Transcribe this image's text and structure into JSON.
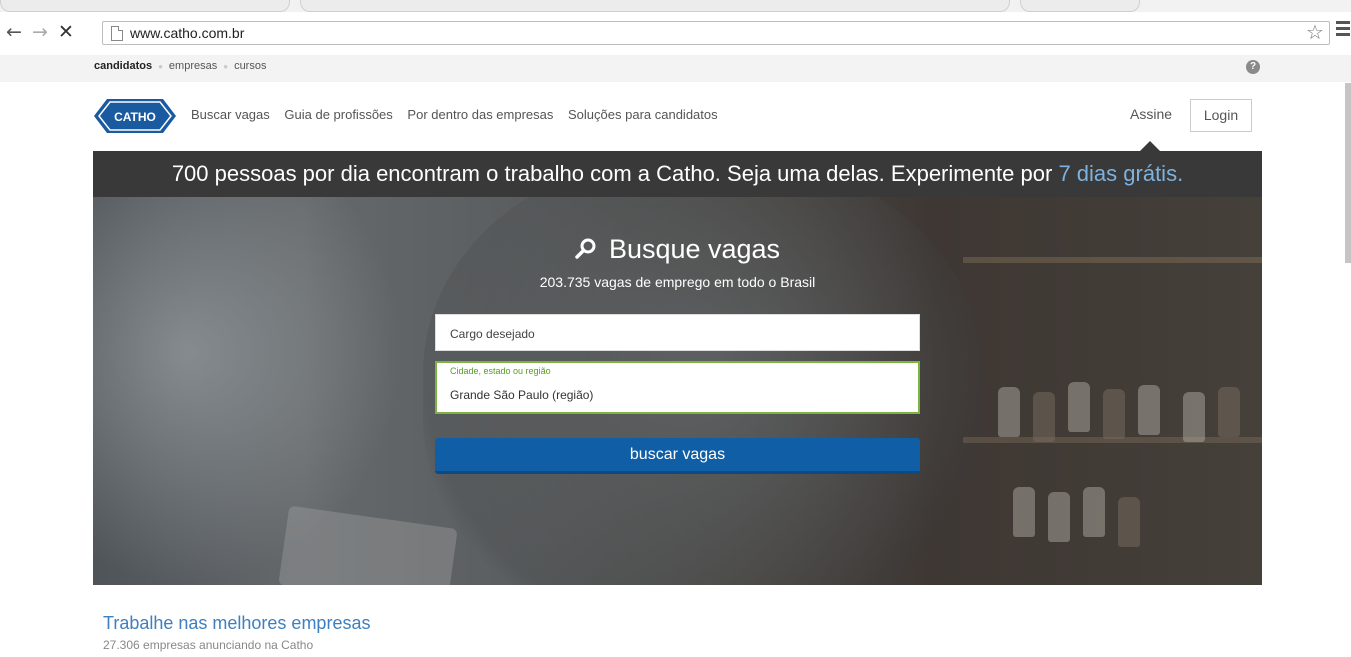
{
  "browser": {
    "back": "←",
    "forward": "→",
    "stop": "✕",
    "url": "www.catho.com.br",
    "star": "☆"
  },
  "topnav": {
    "links": [
      "candidatos",
      "empresas",
      "cursos"
    ],
    "help": "?"
  },
  "header": {
    "logo_text": "CATHO",
    "nav": [
      "Buscar vagas",
      "Guia de profissões",
      "Por dentro das empresas",
      "Soluções para candidatos"
    ],
    "assine": "Assine",
    "login": "Login"
  },
  "promo": {
    "text": "700 pessoas por dia encontram o trabalho com a Catho. Seja uma delas. Experimente por",
    "highlight": "7 dias grátis."
  },
  "search": {
    "title": "Busque vagas",
    "subtitle": "203.735 vagas de emprego em todo o Brasil",
    "cargo_placeholder": "Cargo desejado",
    "cidade_label": "Cidade, estado ou região",
    "cidade_value": "Grande São Paulo (região)",
    "button": "buscar vagas"
  },
  "section": {
    "title": "Trabalhe nas melhores empresas",
    "subtitle": "27.306 empresas anunciando na Catho"
  },
  "colors": {
    "accent_blue": "#105ea6",
    "promo_bg": "#393939",
    "promo_highlight": "#7fb1dd",
    "field_focus_green": "#7cb342",
    "logo_blue": "#1a5aa0"
  }
}
